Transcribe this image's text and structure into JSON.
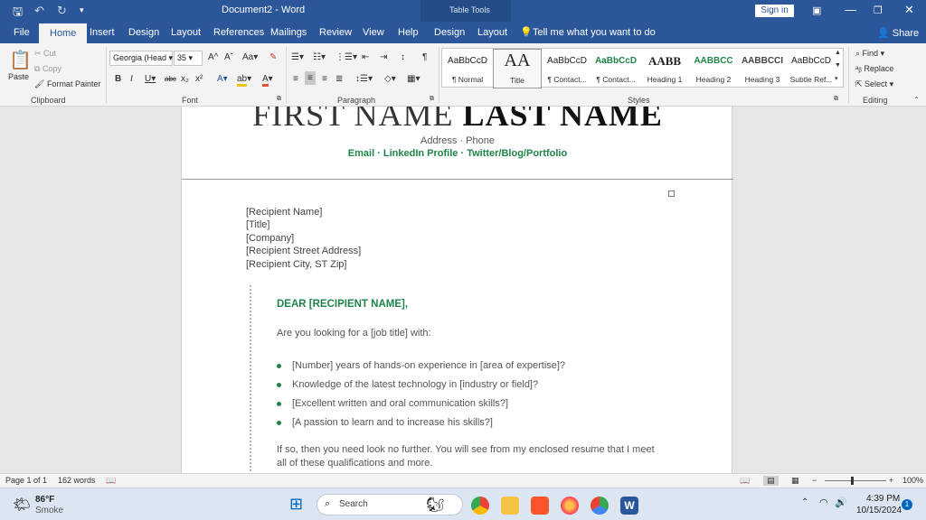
{
  "titlebar": {
    "doc_title": "Document2  -  Word",
    "context_tab": "Table Tools",
    "signin": "Sign in"
  },
  "tabs": [
    "File",
    "Home",
    "Insert",
    "Design",
    "Layout",
    "References",
    "Mailings",
    "Review",
    "View",
    "Help",
    "Design",
    "Layout"
  ],
  "tell_me": "Tell me what you want to do",
  "share": "Share",
  "ribbon": {
    "clipboard": {
      "paste": "Paste",
      "cut": "Cut",
      "copy": "Copy",
      "format_painter": "Format Painter",
      "label": "Clipboard"
    },
    "font": {
      "name": "Georgia (Head",
      "size": "35",
      "label": "Font"
    },
    "paragraph": {
      "label": "Paragraph"
    },
    "styles": {
      "label": "Styles",
      "items": [
        {
          "preview": "AaBbCcD",
          "name": "¶ Normal"
        },
        {
          "preview": "AA",
          "name": "Title"
        },
        {
          "preview": "AaBbCcD",
          "name": "¶ Contact..."
        },
        {
          "preview": "AaBbCcD",
          "name": "¶ Contact..."
        },
        {
          "preview": "AABB",
          "name": "Heading 1"
        },
        {
          "preview": "AABBCC",
          "name": "Heading 2"
        },
        {
          "preview": "AABBCCI",
          "name": "Heading 3"
        },
        {
          "preview": "AaBbCcD",
          "name": "Subtle Ref..."
        }
      ]
    },
    "editing": {
      "find": "Find",
      "replace": "Replace",
      "select": "Select",
      "label": "Editing"
    }
  },
  "document": {
    "first_name": "FIRST NAME",
    "last_name": "LAST NAME",
    "address": "Address · Phone",
    "links": "Email · LinkedIn Profile · Twitter/Blog/Portfolio",
    "recipient": [
      "[Recipient Name]",
      "[Title]",
      "[Company]",
      "[Recipient Street Address]",
      "[Recipient City, ST Zip]"
    ],
    "salutation": "DEAR [RECIPIENT NAME],",
    "intro": "Are you looking for a [job title] with:",
    "bullets": [
      "[Number] years of hands-on experience in [area of expertise]?",
      "Knowledge of the latest technology in [industry or field]?",
      "[Excellent written and oral communication skills?]",
      "[A passion to learn and to increase his skills?]"
    ],
    "closing": "If so, then you need look no further. You will see from my enclosed resume that I meet all of these qualifications and more."
  },
  "status": {
    "page": "Page 1 of 1",
    "words": "162 words",
    "zoom": "100%"
  },
  "taskbar": {
    "weather_temp": "86°F",
    "weather_desc": "Smoke",
    "search": "Search",
    "time": "4:39 PM",
    "date": "10/15/2024",
    "notif": "1"
  },
  "colors": {
    "word_blue": "#2b579a",
    "accent_green": "#1e8449"
  }
}
